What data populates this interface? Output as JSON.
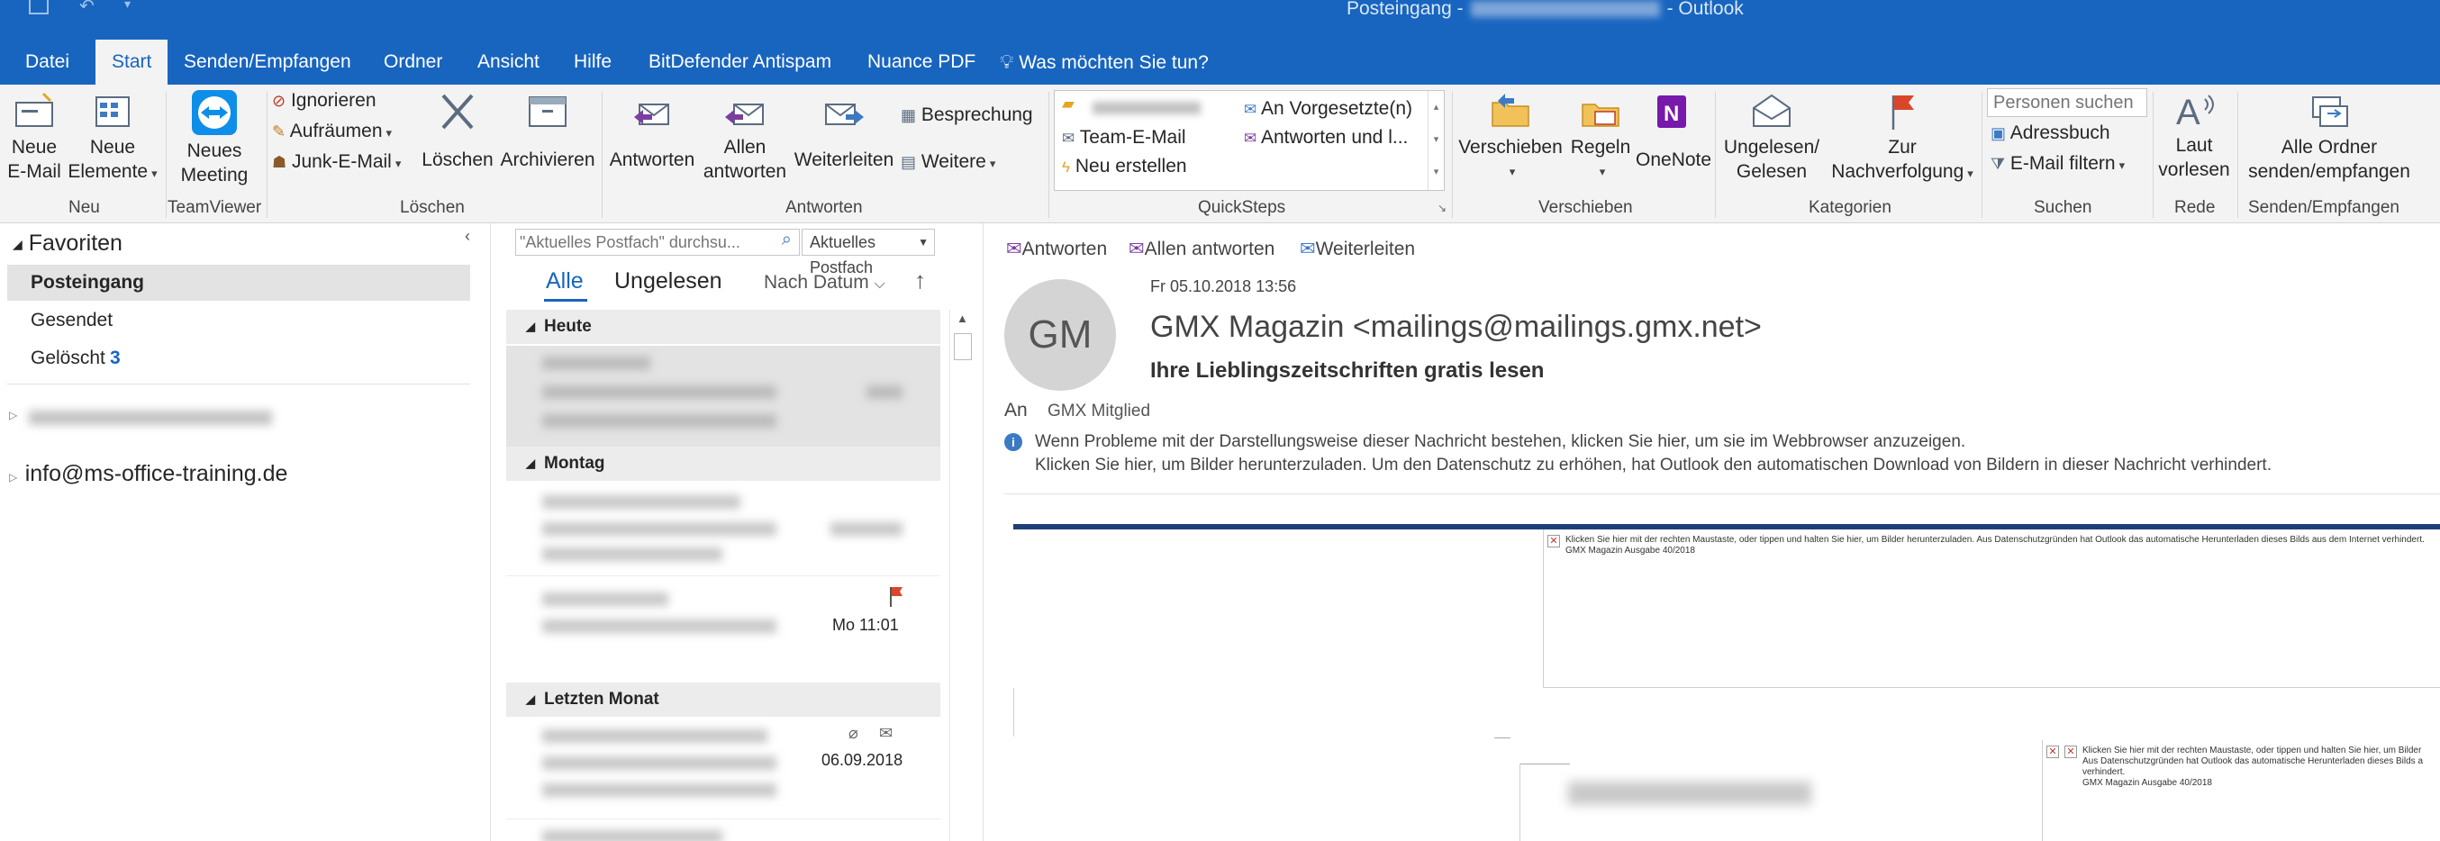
{
  "title_bar": {
    "folder": "Posteingang -",
    "app": "-  Outlook"
  },
  "tabs": [
    {
      "label": "Datei"
    },
    {
      "label": "Start"
    },
    {
      "label": "Senden/Empfangen"
    },
    {
      "label": "Ordner"
    },
    {
      "label": "Ansicht"
    },
    {
      "label": "Hilfe"
    },
    {
      "label": "BitDefender Antispam"
    },
    {
      "label": "Nuance PDF"
    },
    {
      "label": "Was möchten Sie tun?"
    }
  ],
  "ribbon": {
    "new_email_1": "Neue",
    "new_email_2": "E-Mail",
    "new_items_1": "Neue",
    "new_items_2": "Elemente",
    "group_new": "Neu",
    "new_meeting_1": "Neues",
    "new_meeting_2": "Meeting",
    "group_teamviewer": "TeamViewer",
    "ignore": "Ignorieren",
    "cleanup": "Aufräumen",
    "junk": "Junk-E-Mail",
    "delete": "Löschen",
    "archive": "Archivieren",
    "group_delete": "Löschen",
    "reply": "Antworten",
    "reply_all_1": "Allen",
    "reply_all_2": "antworten",
    "forward": "Weiterleiten",
    "meeting": "Besprechung",
    "more": "Weitere",
    "group_respond": "Antworten",
    "qs_team": "Team-E-Mail",
    "qs_new": "Neu erstellen",
    "qs_manager": "An Vorgesetzte(n)",
    "qs_reply_delete": "Antworten und l...",
    "group_quicksteps": "QuickSteps",
    "move": "Verschieben",
    "rules": "Regeln",
    "onenote": "OneNote",
    "group_move": "Verschieben",
    "unread_1": "Ungelesen/",
    "unread_2": "Gelesen",
    "followup_1": "Zur",
    "followup_2": "Nachverfolgung",
    "group_tags": "Kategorien",
    "people_search_placeholder": "Personen suchen",
    "addressbook": "Adressbuch",
    "filter_email": "E-Mail filtern",
    "group_find": "Suchen",
    "read_aloud_1": "Laut",
    "read_aloud_2": "vorlesen",
    "group_speech": "Rede",
    "send_all_1": "Alle Ordner",
    "send_all_2": "senden/empfangen",
    "group_send": "Senden/Empfangen"
  },
  "nav": {
    "favorites": "Favoriten",
    "items": [
      {
        "label": "Posteingang",
        "count": ""
      },
      {
        "label": "Gesendet",
        "count": ""
      },
      {
        "label": "Gelöscht",
        "count": "3"
      }
    ],
    "account": "info@ms-office-training.de"
  },
  "list": {
    "search_placeholder": "\"Aktuelles Postfach\" durchsu...",
    "scope": "Aktuelles Postfach",
    "filter_all": "Alle",
    "filter_unread": "Ungelesen",
    "sort": "Nach Datum",
    "groups": [
      {
        "label": "Heute"
      },
      {
        "label": "Montag"
      },
      {
        "label": "Letzten Monat"
      }
    ],
    "item_monday_time": "Mo 11:01",
    "item_lastmonth_date": "06.09.2018"
  },
  "reading": {
    "reply": "Antworten",
    "reply_all": "Allen antworten",
    "forward": "Weiterleiten",
    "date": "Fr 05.10.2018 13:56",
    "avatar_initials": "GM",
    "sender": "GMX Magazin <mailings@mailings.gmx.net>",
    "subject": "Ihre Lieblingszeitschriften gratis lesen",
    "to_label": "An",
    "to_value": "GMX Mitglied",
    "info_line1": "Wenn Probleme mit der Darstellungsweise dieser Nachricht bestehen, klicken Sie hier, um sie im Webbrowser anzuzeigen.",
    "info_line2": "Klicken Sie hier, um Bilder herunterzuladen. Um den Datenschutz zu erhöhen, hat Outlook den automatischen Download von Bildern in dieser Nachricht verhindert.",
    "img_text1": "Klicken Sie hier mit der rechten Maustaste, oder tippen und halten Sie hier, um Bilder herunterzuladen. Aus Datenschutzgründen hat Outlook das automatische Herunterladen dieses Bilds aus dem Internet verhindert.",
    "img_caption1": "GMX Magazin Ausgabe 40/2018",
    "img_text2a": "Klicken Sie hier mit der rechten Maustaste, oder tippen und halten Sie hier, um Bilder",
    "img_text2b": "Aus Datenschutzgründen hat Outlook das automatische Herunterladen dieses Bilds a",
    "img_text2c": "verhindert.",
    "img_caption2": "GMX Magazin Ausgabe 40/2018"
  },
  "colors": {
    "accent": "#1865c0",
    "ribbon_bg": "#f3f3f3",
    "selected": "#e3e3e3",
    "flag": "#d9472b"
  }
}
